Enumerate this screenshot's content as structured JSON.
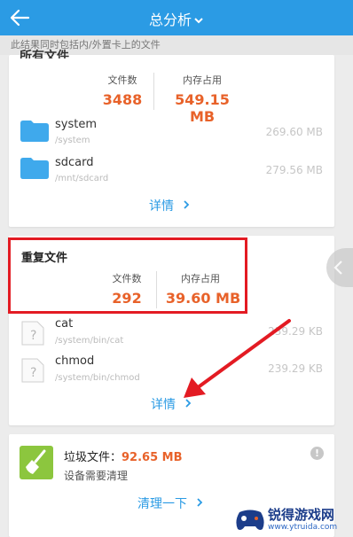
{
  "header": {
    "title": "总分析",
    "back_icon": "arrow-left-icon",
    "dropdown_icon": "chevron-down-icon"
  },
  "notice": "此结果同时包括内/外置卡上的文件",
  "section1": {
    "partial_title": "所有文件",
    "stat1": {
      "label": "文件数",
      "value": "3488"
    },
    "stat2": {
      "label": "内存占用",
      "value": "549.15 MB"
    },
    "rows": [
      {
        "name": "system",
        "path": "/system",
        "size": "269.60 MB"
      },
      {
        "name": "sdcard",
        "path": "/mnt/sdcard",
        "size": "279.56 MB"
      }
    ],
    "detail": "详情"
  },
  "section2": {
    "title": "重复文件",
    "stat1": {
      "label": "文件数",
      "value": "292"
    },
    "stat2": {
      "label": "内存占用",
      "value": "39.60 MB"
    },
    "rows": [
      {
        "name": "cat",
        "path": "/system/bin/cat",
        "size": "239.29 KB"
      },
      {
        "name": "chmod",
        "path": "/system/bin/chmod",
        "size": "239.29 KB"
      }
    ],
    "detail": "详情"
  },
  "section3": {
    "label": "垃圾文件：",
    "value": "92.65 MB",
    "subtitle": "设备需要清理",
    "action": "清理一下"
  },
  "watermark": {
    "title": "锐得游戏网",
    "url": "www.ytruida.com"
  },
  "colors": {
    "accent": "#2b9be4",
    "value": "#e8622a",
    "highlight": "#e31b23"
  }
}
